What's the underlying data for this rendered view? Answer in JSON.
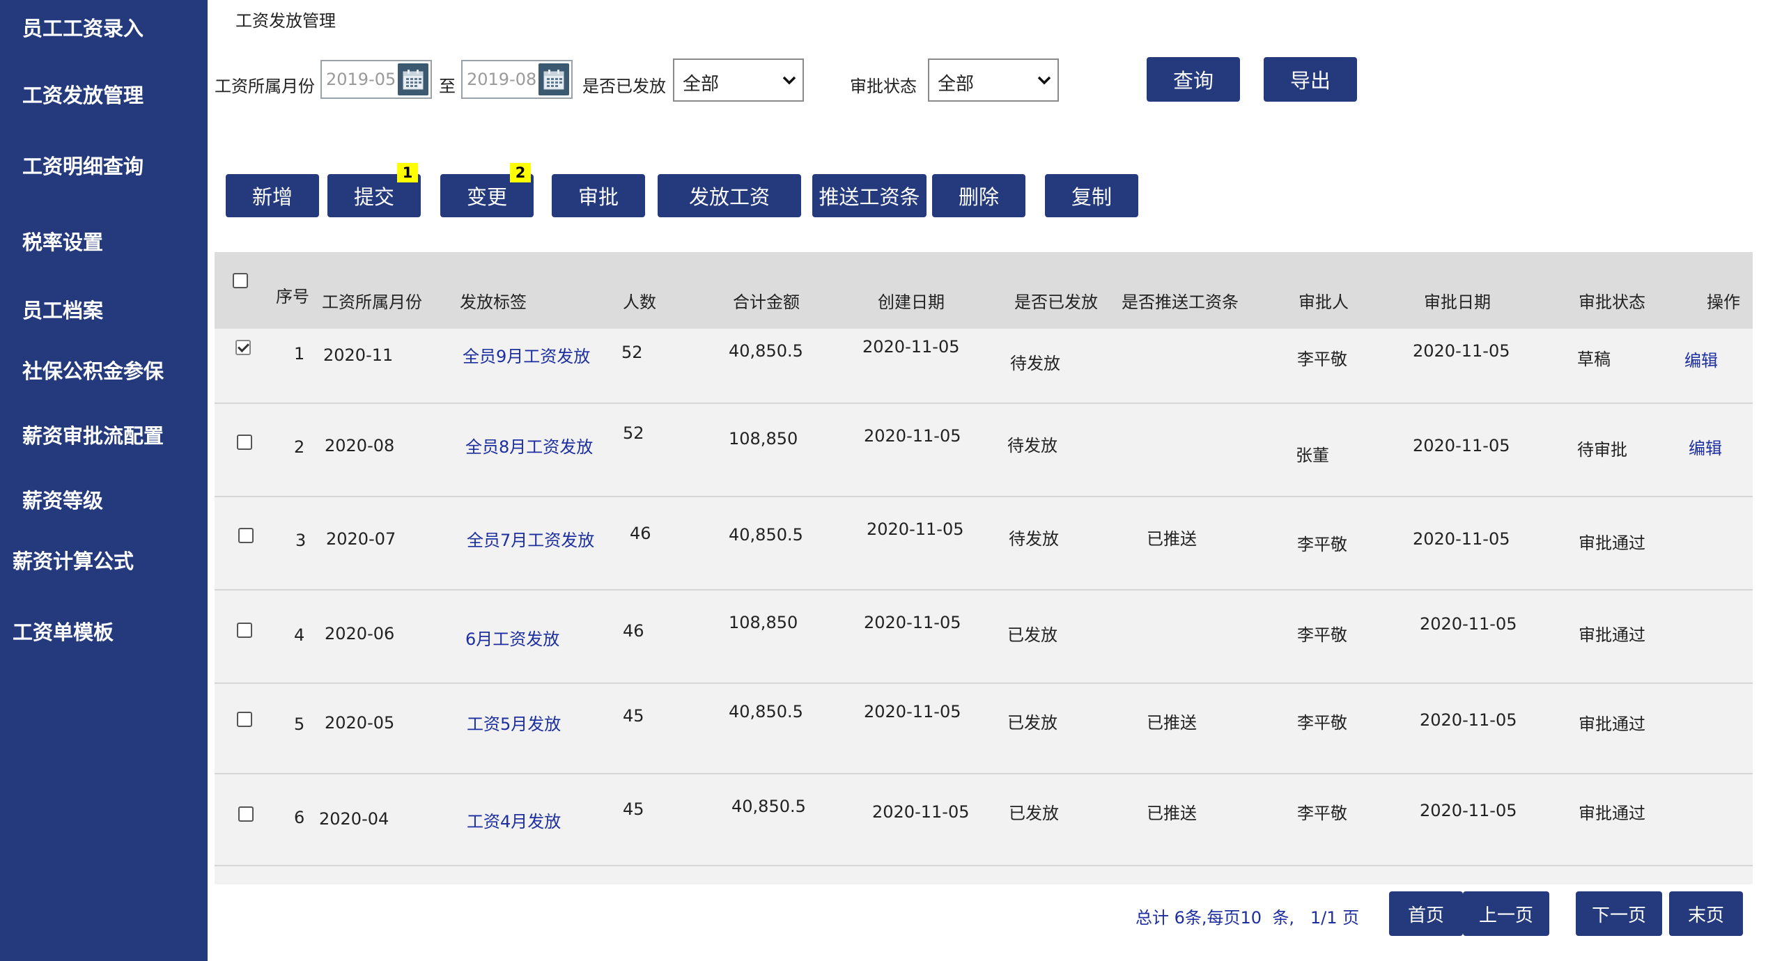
{
  "sidebar": {
    "items": [
      {
        "label": "员工工资录入"
      },
      {
        "label": "工资发放管理"
      },
      {
        "label": "工资明细查询"
      },
      {
        "label": "税率设置"
      },
      {
        "label": "员工档案"
      },
      {
        "label": "社保公积金参保"
      },
      {
        "label": "薪资审批流配置"
      },
      {
        "label": "薪资等级"
      },
      {
        "label": "薪资计算公式"
      },
      {
        "label": "工资单模板"
      }
    ]
  },
  "header": {
    "title": "工资发放管理"
  },
  "filters": {
    "month_label": "工资所属月份",
    "month_from": "2019-05",
    "to_label": "至",
    "month_to": "2019-08",
    "issued_label": "是否已发放",
    "issued_value": "全部",
    "approval_label": "审批状态",
    "approval_value": "全部",
    "query_button": "查询",
    "export_button": "导出"
  },
  "toolbar": {
    "add": "新增",
    "submit": "提交",
    "submit_badge": "1",
    "change": "变更",
    "change_badge": "2",
    "approve": "审批",
    "pay": "发放工资",
    "push": "推送工资条",
    "delete": "删除",
    "copy": "复制"
  },
  "table": {
    "headers": [
      "序号",
      "工资所属月份",
      "发放标签",
      "人数",
      "合计金额",
      "创建日期",
      "是否已发放",
      "是否推送工资条",
      "审批人",
      "审批日期",
      "审批状态",
      "操作"
    ],
    "rows": [
      {
        "no": "1",
        "month": "2020-11",
        "tag": "全员9月工资发放",
        "count": "52",
        "amount": "40,850.5",
        "created": "2020-11-05",
        "issued": "待发放",
        "pushed": "",
        "approver": "李平敬",
        "approve_date": "2020-11-05",
        "status": "草稿",
        "action": "编辑",
        "checked": true
      },
      {
        "no": "2",
        "month": "2020-08",
        "tag": "全员8月工资发放",
        "count": "52",
        "amount": "108,850",
        "created": "2020-11-05",
        "issued": "待发放",
        "pushed": "",
        "approver": "张董",
        "approve_date": "2020-11-05",
        "status": "待审批",
        "action": "编辑",
        "checked": false
      },
      {
        "no": "3",
        "month": "2020-07",
        "tag": "全员7月工资发放",
        "count": "46",
        "amount": "40,850.5",
        "created": "2020-11-05",
        "issued": "待发放",
        "pushed": "已推送",
        "approver": "李平敬",
        "approve_date": "2020-11-05",
        "status": "审批通过",
        "action": "",
        "checked": false
      },
      {
        "no": "4",
        "month": "2020-06",
        "tag": "6月工资发放",
        "count": "46",
        "amount": "108,850",
        "created": "2020-11-05",
        "issued": "已发放",
        "pushed": "",
        "approver": "李平敬",
        "approve_date": "2020-11-05",
        "status": "审批通过",
        "action": "",
        "checked": false
      },
      {
        "no": "5",
        "month": "2020-05",
        "tag": "工资5月发放",
        "count": "45",
        "amount": "40,850.5",
        "created": "2020-11-05",
        "issued": "已发放",
        "pushed": "已推送",
        "approver": "李平敬",
        "approve_date": "2020-11-05",
        "status": "审批通过",
        "action": "",
        "checked": false
      },
      {
        "no": "6",
        "month": "2020-04",
        "tag": "工资4月发放",
        "count": "45",
        "amount": "40,850.5",
        "created": "2020-11-05",
        "issued": "已发放",
        "pushed": "已推送",
        "approver": "李平敬",
        "approve_date": "2020-11-05",
        "status": "审批通过",
        "action": "",
        "checked": false
      }
    ]
  },
  "pagination": {
    "info": "总计 6条,每页10  条,   1/1 页",
    "first": "首页",
    "prev": "上一页",
    "next": "下一页",
    "last": "末页"
  },
  "colors": {
    "primary": "#243a7d",
    "link": "#1d2fa0",
    "badge": "#ffff00"
  }
}
